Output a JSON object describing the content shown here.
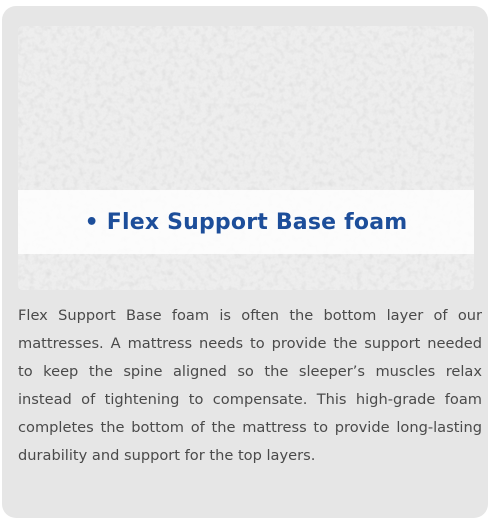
{
  "feature": {
    "bullet": "•",
    "title": "Flex Support Base foam",
    "description": "Flex Support  Base foam is often the bottom layer of our mattresses. A mattress needs to provide the support needed to keep the spine aligned so the sleeper’s muscles relax instead of tightening to compensate. This high-grade foam completes the bottom of the mattress to provide long-lasting durability and support for the top layers."
  },
  "colors": {
    "title": "#1d4e9a",
    "card_background": "#e6e6e6",
    "body_text": "#4a4a4a"
  }
}
